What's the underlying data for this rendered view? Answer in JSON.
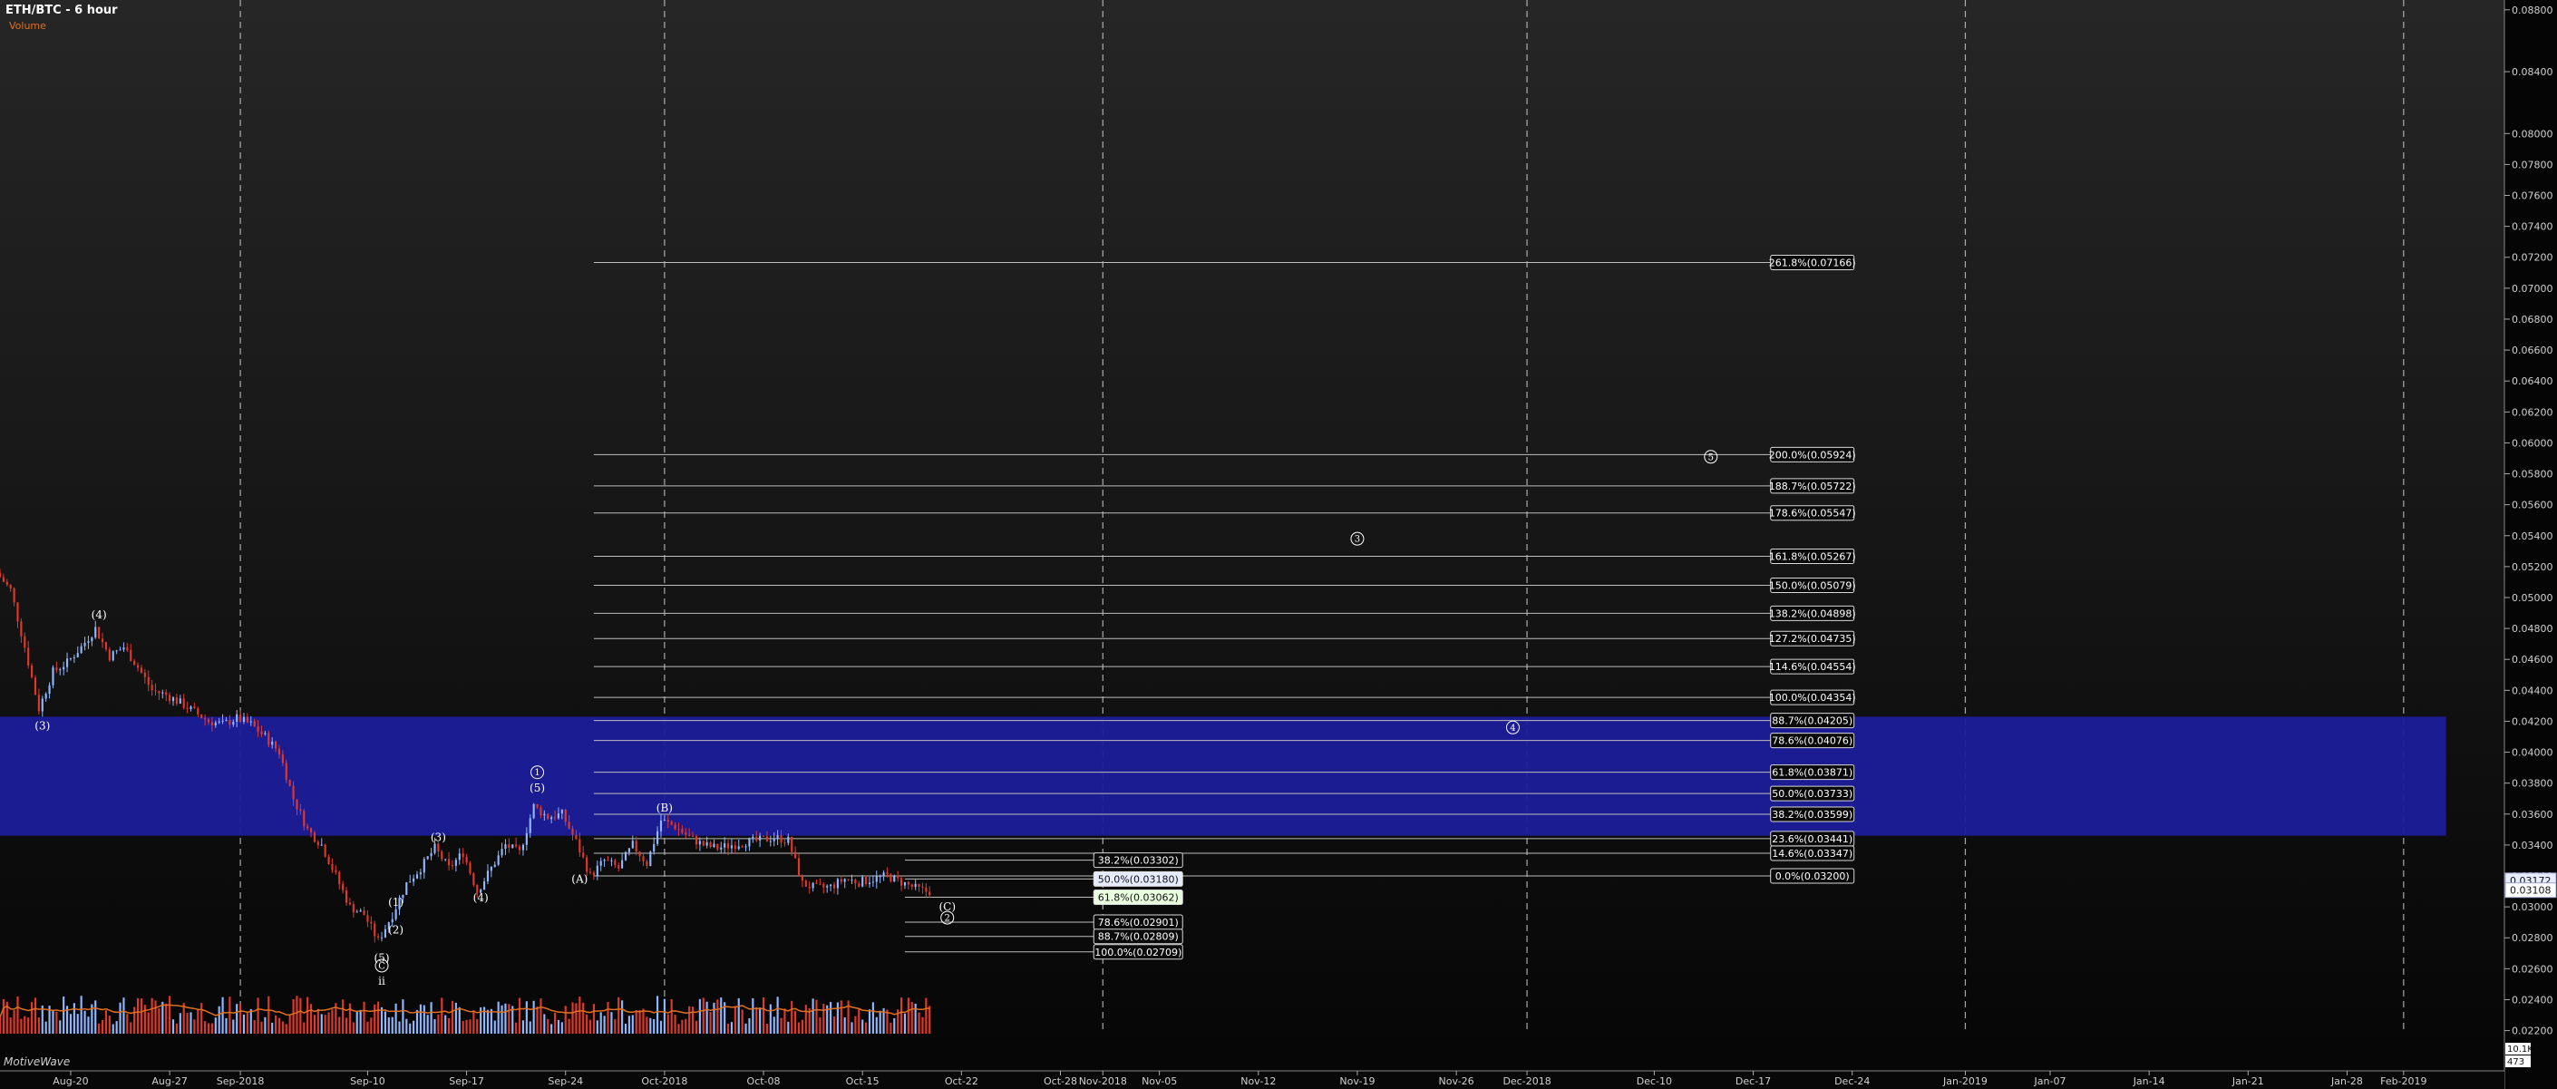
{
  "header": {
    "title": "ETH/BTC - 6 hour",
    "indicator_label": "Volume",
    "brand": "MotiveWave"
  },
  "colors": {
    "bull": "#8fb8ff",
    "bear": "#e0392a",
    "zone": "#1c1c9a",
    "fib": "#bdbdbd",
    "axis": "#9a9a9a"
  },
  "chart_data": {
    "type": "candlestick",
    "title": "ETH/BTC - 6 hour",
    "y_axis": {
      "min": 0.0218,
      "max": 0.0884,
      "ticks": [
        "0.08800",
        "0.08400",
        "0.08000",
        "0.07800",
        "0.07600",
        "0.07400",
        "0.07200",
        "0.07000",
        "0.06800",
        "0.06600",
        "0.06400",
        "0.06200",
        "0.06000",
        "0.05800",
        "0.05600",
        "0.05400",
        "0.05200",
        "0.05000",
        "0.04800",
        "0.04600",
        "0.04400",
        "0.04200",
        "0.04000",
        "0.03800",
        "0.03600",
        "0.03400",
        "0.03200",
        "0.03000",
        "0.02800",
        "0.02600",
        "0.02400",
        "0.02200"
      ],
      "current_labels": [
        {
          "text": "0.03172",
          "value": 0.03172,
          "kind": "current"
        },
        {
          "text": "0.03108",
          "value": 0.03108,
          "kind": "level"
        }
      ],
      "volume_labels": [
        "10.1K",
        "473"
      ]
    },
    "x_axis": {
      "min": "2018-08-15",
      "max": "2019-02-08",
      "ticks": [
        {
          "date": "2018-08-20",
          "label": "Aug-20"
        },
        {
          "date": "2018-08-27",
          "label": "Aug-27"
        },
        {
          "date": "2018-09-01",
          "label": "Sep-2018"
        },
        {
          "date": "2018-09-10",
          "label": "Sep-10"
        },
        {
          "date": "2018-09-17",
          "label": "Sep-17"
        },
        {
          "date": "2018-09-24",
          "label": "Sep-24"
        },
        {
          "date": "2018-10-01",
          "label": "Oct-2018"
        },
        {
          "date": "2018-10-08",
          "label": "Oct-08"
        },
        {
          "date": "2018-10-15",
          "label": "Oct-15"
        },
        {
          "date": "2018-10-22",
          "label": "Oct-22"
        },
        {
          "date": "2018-10-29",
          "label": "Oct-28"
        },
        {
          "date": "2018-11-01",
          "label": "Nov-2018"
        },
        {
          "date": "2018-11-05",
          "label": "Nov-05"
        },
        {
          "date": "2018-11-12",
          "label": "Nov-12"
        },
        {
          "date": "2018-11-19",
          "label": "Nov-19"
        },
        {
          "date": "2018-11-26",
          "label": "Nov-26"
        },
        {
          "date": "2018-12-01",
          "label": "Dec-2018"
        },
        {
          "date": "2018-12-10",
          "label": "Dec-10"
        },
        {
          "date": "2018-12-17",
          "label": "Dec-17"
        },
        {
          "date": "2018-12-24",
          "label": "Dec-24"
        },
        {
          "date": "2019-01-01",
          "label": "Jan-2019"
        },
        {
          "date": "2019-01-07",
          "label": "Jan-07"
        },
        {
          "date": "2019-01-14",
          "label": "Jan-14"
        },
        {
          "date": "2019-01-21",
          "label": "Jan-21"
        },
        {
          "date": "2019-01-28",
          "label": "Jan-28"
        },
        {
          "date": "2019-02-01",
          "label": "Feb-2019"
        }
      ],
      "separators": [
        "2018-09-01",
        "2018-10-01",
        "2018-11-01",
        "2018-12-01",
        "2019-01-01",
        "2019-02-01"
      ]
    },
    "price_path": [
      [
        "2018-08-15",
        0.0516
      ],
      [
        "2018-08-16",
        0.0505
      ],
      [
        "2018-08-17",
        0.0468
      ],
      [
        "2018-08-18",
        0.0428
      ],
      [
        "2018-08-19",
        0.0452
      ],
      [
        "2018-08-20",
        0.0458
      ],
      [
        "2018-08-21",
        0.0468
      ],
      [
        "2018-08-22",
        0.048
      ],
      [
        "2018-08-23",
        0.0462
      ],
      [
        "2018-08-24",
        0.0468
      ],
      [
        "2018-08-25",
        0.0455
      ],
      [
        "2018-08-26",
        0.044
      ],
      [
        "2018-08-27",
        0.0437
      ],
      [
        "2018-08-28",
        0.0432
      ],
      [
        "2018-08-29",
        0.0426
      ],
      [
        "2018-08-30",
        0.042
      ],
      [
        "2018-08-31",
        0.0418
      ],
      [
        "2018-09-01",
        0.0422
      ],
      [
        "2018-09-02",
        0.0418
      ],
      [
        "2018-09-03",
        0.041
      ],
      [
        "2018-09-04",
        0.04
      ],
      [
        "2018-09-05",
        0.037
      ],
      [
        "2018-09-06",
        0.035
      ],
      [
        "2018-09-07",
        0.034
      ],
      [
        "2018-09-08",
        0.032
      ],
      [
        "2018-09-09",
        0.03
      ],
      [
        "2018-09-10",
        0.0295
      ],
      [
        "2018-09-11",
        0.0278
      ],
      [
        "2018-09-12",
        0.0295
      ],
      [
        "2018-09-13",
        0.0315
      ],
      [
        "2018-09-14",
        0.0325
      ],
      [
        "2018-09-15",
        0.0338
      ],
      [
        "2018-09-16",
        0.0325
      ],
      [
        "2018-09-17",
        0.0335
      ],
      [
        "2018-09-18",
        0.031
      ],
      [
        "2018-09-19",
        0.0325
      ],
      [
        "2018-09-20",
        0.034
      ],
      [
        "2018-09-21",
        0.0335
      ],
      [
        "2018-09-22",
        0.0365
      ],
      [
        "2018-09-23",
        0.0358
      ],
      [
        "2018-09-24",
        0.036
      ],
      [
        "2018-09-25",
        0.0342
      ],
      [
        "2018-09-26",
        0.032
      ],
      [
        "2018-09-27",
        0.033
      ],
      [
        "2018-09-28",
        0.0325
      ],
      [
        "2018-09-29",
        0.034
      ],
      [
        "2018-09-30",
        0.0328
      ],
      [
        "2018-10-01",
        0.0356
      ],
      [
        "2018-10-02",
        0.0352
      ],
      [
        "2018-10-03",
        0.0345
      ],
      [
        "2018-10-04",
        0.034
      ],
      [
        "2018-10-05",
        0.0338
      ],
      [
        "2018-10-06",
        0.034
      ],
      [
        "2018-10-07",
        0.0342
      ],
      [
        "2018-10-08",
        0.0343
      ],
      [
        "2018-10-09",
        0.0345
      ],
      [
        "2018-10-10",
        0.0343
      ],
      [
        "2018-10-11",
        0.0315
      ],
      [
        "2018-10-12",
        0.0312
      ],
      [
        "2018-10-13",
        0.0313
      ],
      [
        "2018-10-14",
        0.0318
      ],
      [
        "2018-10-15",
        0.0316
      ],
      [
        "2018-10-16",
        0.0318
      ],
      [
        "2018-10-17",
        0.032
      ],
      [
        "2018-10-18",
        0.0316
      ],
      [
        "2018-10-19",
        0.0312
      ],
      [
        "2018-10-19T18:00",
        0.031
      ]
    ],
    "volume_scale": {
      "max": "10.1K",
      "min": "473"
    },
    "supply_zone": {
      "top": 0.0423,
      "bottom": 0.0346,
      "end": "2019-02-04"
    },
    "fib_extension": {
      "start": "2018-09-26",
      "end": "2018-12-24",
      "levels": [
        {
          "text": "261.8%(0.07166)",
          "value": 0.07166
        },
        {
          "text": "200.0%(0.05924)",
          "value": 0.05924
        },
        {
          "text": "188.7%(0.05722)",
          "value": 0.05722
        },
        {
          "text": "178.6%(0.05547)",
          "value": 0.05547
        },
        {
          "text": "161.8%(0.05267)",
          "value": 0.05267
        },
        {
          "text": "150.0%(0.05079)",
          "value": 0.05079
        },
        {
          "text": "138.2%(0.04898)",
          "value": 0.04898
        },
        {
          "text": "127.2%(0.04735)",
          "value": 0.04735
        },
        {
          "text": "114.6%(0.04554)",
          "value": 0.04554
        },
        {
          "text": "100.0%(0.04354)",
          "value": 0.04354
        },
        {
          "text": "88.7%(0.04205)",
          "value": 0.04205
        },
        {
          "text": "78.6%(0.04076)",
          "value": 0.04076
        },
        {
          "text": "61.8%(0.03871)",
          "value": 0.03871
        },
        {
          "text": "50.0%(0.03733)",
          "value": 0.03733
        },
        {
          "text": "38.2%(0.03599)",
          "value": 0.03599
        },
        {
          "text": "23.6%(0.03441)",
          "value": 0.03441
        },
        {
          "text": "14.6%(0.03347)",
          "value": 0.03347
        },
        {
          "text": "0.0%(0.03200)",
          "value": 0.032
        }
      ]
    },
    "fib_retracement": {
      "start": "2018-10-18",
      "end": "2018-11-06",
      "levels": [
        {
          "text": "38.2%(0.03302)",
          "value": 0.03302,
          "highlight": ""
        },
        {
          "text": "50.0%(0.03180)",
          "value": 0.0318,
          "highlight": "blue"
        },
        {
          "text": "61.8%(0.03062)",
          "value": 0.03062,
          "highlight": "green"
        },
        {
          "text": "78.6%(0.02901)",
          "value": 0.02901,
          "highlight": ""
        },
        {
          "text": "88.7%(0.02809)",
          "value": 0.02809,
          "highlight": ""
        },
        {
          "text": "100.0%(0.02709)",
          "value": 0.02709,
          "highlight": ""
        }
      ]
    },
    "wave_labels": [
      {
        "text": "(4)",
        "date": "2018-08-22",
        "value": 0.0489,
        "circled": false
      },
      {
        "text": "(3)",
        "date": "2018-08-18",
        "value": 0.0417,
        "circled": false
      },
      {
        "text": "(3)",
        "date": "2018-09-15",
        "value": 0.0345,
        "circled": false
      },
      {
        "text": "(1)",
        "date": "2018-09-12",
        "value": 0.0303,
        "circled": false
      },
      {
        "text": "(2)",
        "date": "2018-09-12",
        "value": 0.0285,
        "circled": false
      },
      {
        "text": "(4)",
        "date": "2018-09-18",
        "value": 0.0306,
        "circled": false
      },
      {
        "text": "(5)",
        "date": "2018-09-11",
        "value": 0.0267,
        "circled": false
      },
      {
        "text": "C",
        "date": "2018-09-11",
        "value": 0.0262,
        "circled": true
      },
      {
        "text": "ii",
        "date": "2018-09-11",
        "value": 0.0252,
        "circled": false
      },
      {
        "text": "1",
        "date": "2018-09-22",
        "value": 0.0387,
        "circled": true
      },
      {
        "text": "(5)",
        "date": "2018-09-22",
        "value": 0.0377,
        "circled": false
      },
      {
        "text": "(B)",
        "date": "2018-10-01",
        "value": 0.0364,
        "circled": false
      },
      {
        "text": "(A)",
        "date": "2018-09-25",
        "value": 0.0318,
        "circled": false
      },
      {
        "text": "(C)",
        "date": "2018-10-21",
        "value": 0.03,
        "circled": false
      },
      {
        "text": "2",
        "date": "2018-10-21",
        "value": 0.0293,
        "circled": true
      },
      {
        "text": "3",
        "date": "2018-11-19",
        "value": 0.0538,
        "circled": true
      },
      {
        "text": "4",
        "date": "2018-11-30",
        "value": 0.0416,
        "circled": true
      },
      {
        "text": "5",
        "date": "2018-12-14",
        "value": 0.0591,
        "circled": true
      }
    ]
  }
}
